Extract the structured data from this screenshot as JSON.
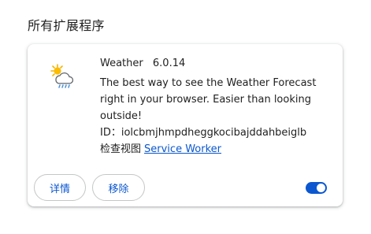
{
  "section": {
    "title": "所有扩展程序"
  },
  "extension": {
    "name": "Weather",
    "version": "6.0.14",
    "description": "The best way to see the Weather Forecast right in your browser. Easier than looking outside!",
    "id_label": "ID：",
    "id_value": "iolcbmjhmpdheggkocibajddahbeiglb",
    "inspect_label": "检查视图",
    "inspect_link": "Service Worker",
    "icon": "weather-partly-cloudy-rain-icon",
    "enabled": true
  },
  "buttons": {
    "details": "详情",
    "remove": "移除"
  },
  "colors": {
    "accent": "#0b57d0",
    "button_border": "#c4c7c5",
    "text": "#1f1f1f"
  }
}
